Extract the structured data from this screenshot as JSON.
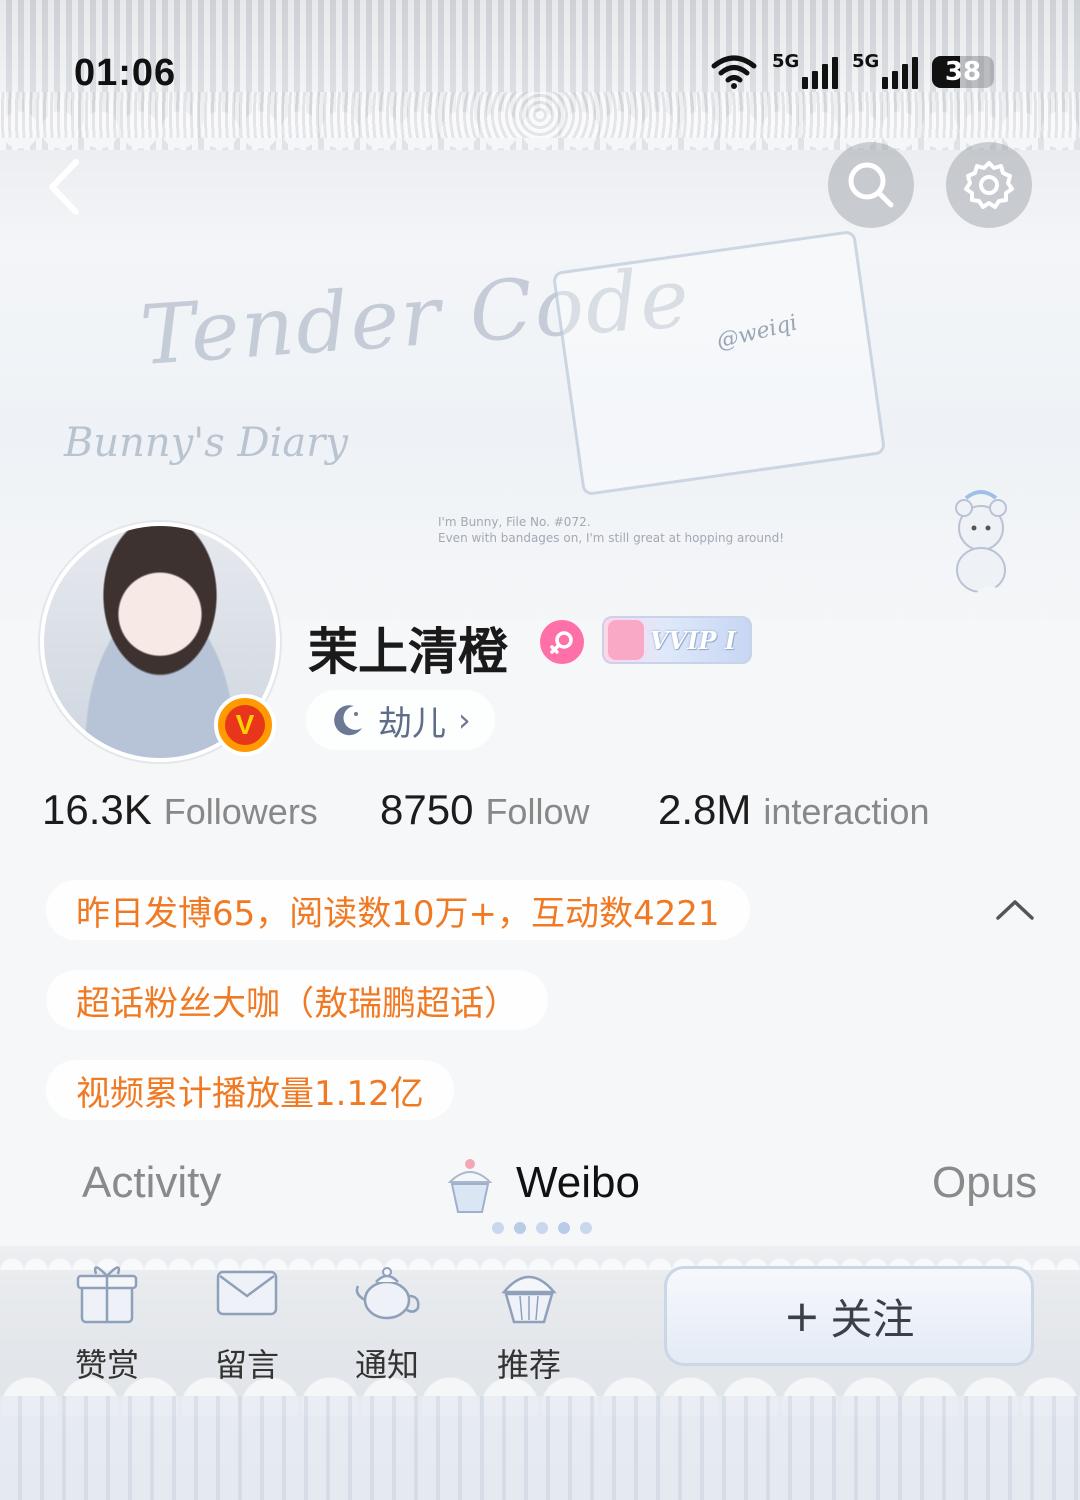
{
  "status_bar": {
    "time": "01:06",
    "signal1_label": "5G",
    "signal2_label": "5G",
    "battery": "38"
  },
  "banner": {
    "title": "Tender Code",
    "subtitle": "Bunny's Diary",
    "card_name": "@weiqi",
    "file_line1": "I'm Bunny, File No. #072.",
    "file_line2": "Even with bandages on, I'm still great at hopping around!",
    "icons": [
      "back-arrow",
      "search",
      "settings"
    ]
  },
  "profile": {
    "name": "茉上清橙",
    "vip_label": "VVIP I",
    "level_label": "劫儿",
    "verified_badge": "V",
    "colors": {
      "gender_badge": "#ff6fa8",
      "verified": "#e7361b"
    }
  },
  "stats": [
    {
      "num": "16.3K",
      "label": "Followers"
    },
    {
      "num": "8750",
      "label": "Follow"
    },
    {
      "num": "2.8M",
      "label": "interaction"
    }
  ],
  "info": {
    "line1": "昨日发博65，阅读数10万+，互动数4221",
    "line2": "超话粉丝大咖（敖瑞鹏超话）",
    "line3": "视频累计播放量1.12亿",
    "color": "#f07a23"
  },
  "tabs": {
    "activity": "Activity",
    "weibo": "Weibo",
    "opus": "Opus",
    "active": "weibo"
  },
  "bottom_nav": {
    "reward": "赞赏",
    "message": "留言",
    "notify": "通知",
    "recommend": "推荐",
    "follow_button": "关注",
    "follow_plus": "+"
  }
}
